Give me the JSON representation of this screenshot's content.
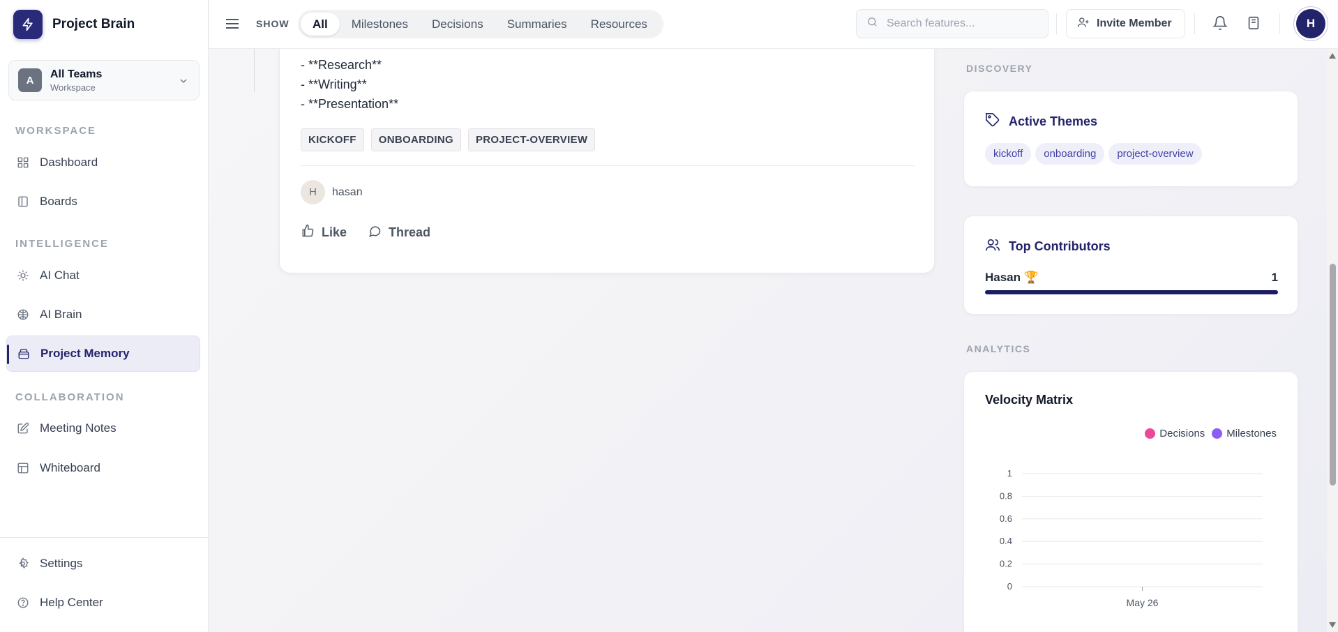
{
  "app": {
    "brand": "Project Brain"
  },
  "team": {
    "initial": "A",
    "name": "All Teams",
    "subtitle": "Workspace"
  },
  "sidebar": {
    "sections": [
      {
        "label": "WORKSPACE"
      },
      {
        "label": "INTELLIGENCE"
      },
      {
        "label": "COLLABORATION"
      }
    ],
    "items": [
      {
        "label": "Dashboard",
        "icon": "grid-icon"
      },
      {
        "label": "Boards",
        "icon": "board-icon"
      },
      {
        "label": "AI Chat",
        "icon": "lightbulb-icon"
      },
      {
        "label": "AI Brain",
        "icon": "brain-icon"
      },
      {
        "label": "Project Memory",
        "icon": "archive-icon",
        "active": true
      },
      {
        "label": "Meeting Notes",
        "icon": "edit-icon"
      },
      {
        "label": "Whiteboard",
        "icon": "layout-icon"
      }
    ],
    "bottom": [
      {
        "label": "Settings",
        "icon": "gear-icon"
      },
      {
        "label": "Help Center",
        "icon": "help-icon"
      }
    ]
  },
  "topbar": {
    "show_label": "SHOW",
    "filters": [
      "All",
      "Milestones",
      "Decisions",
      "Summaries",
      "Resources"
    ],
    "active_filter": "All",
    "search_placeholder": "Search features...",
    "invite_label": "Invite Member",
    "user_initial": "H"
  },
  "post": {
    "lines": [
      "- **Research**",
      "- **Writing**",
      "- **Presentation**"
    ],
    "tags": [
      "KICKOFF",
      "ONBOARDING",
      "PROJECT-OVERVIEW"
    ],
    "author_initial": "H",
    "author": "hasan",
    "like_label": "Like",
    "thread_label": "Thread"
  },
  "rail": {
    "discovery_label": "DISCOVERY",
    "themes": {
      "title": "Active Themes",
      "chips": [
        "kickoff",
        "onboarding",
        "project-overview"
      ]
    },
    "contributors": {
      "title": "Top Contributors",
      "rows": [
        {
          "name": "Hasan 🏆",
          "count": "1",
          "share": 1.0
        }
      ]
    },
    "analytics_label": "ANALYTICS",
    "velocity_title": "Velocity Matrix"
  },
  "colors": {
    "accent": "#23236b",
    "decisions": "#ec4899",
    "milestones": "#8b5cf6"
  },
  "chart_data": {
    "type": "line",
    "title": "Velocity Matrix",
    "x": [
      "May 26"
    ],
    "series": [
      {
        "name": "Decisions",
        "values": [
          0
        ]
      },
      {
        "name": "Milestones",
        "values": [
          0
        ]
      }
    ],
    "yticks": [
      "0",
      "0.2",
      "0.4",
      "0.6",
      "0.8",
      "1"
    ],
    "ylim": [
      0,
      1
    ],
    "grid": true,
    "legend": "top-right"
  }
}
